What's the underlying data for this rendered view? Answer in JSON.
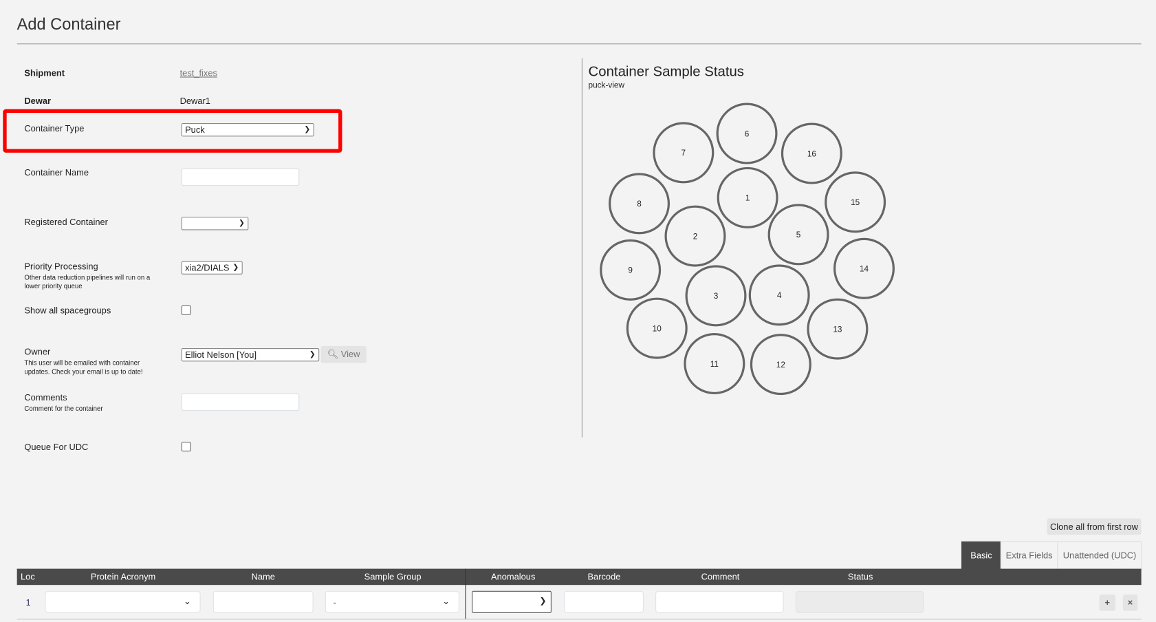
{
  "page": {
    "title": "Add Container"
  },
  "form": {
    "shipment": {
      "label": "Shipment",
      "value": "test_fixes"
    },
    "dewar": {
      "label": "Dewar",
      "value": "Dewar1"
    },
    "container_type": {
      "label": "Container Type",
      "value": "Puck"
    },
    "container_name": {
      "label": "Container Name",
      "value": ""
    },
    "registered_container": {
      "label": "Registered Container",
      "value": ""
    },
    "priority_processing": {
      "label": "Priority Processing",
      "help": "Other data reduction pipelines will run on a lower priority queue",
      "value": "xia2/DIALS"
    },
    "show_all_spacegroups": {
      "label": "Show all spacegroups",
      "checked": false
    },
    "owner": {
      "label": "Owner",
      "help": "This user will be emailed with container updates. Check your email is up to date!",
      "value": "Elliot Nelson [You]",
      "view_label": "View"
    },
    "comments": {
      "label": "Comments",
      "help": "Comment for the container",
      "value": ""
    },
    "queue_for_udc": {
      "label": "Queue For UDC",
      "checked": false
    }
  },
  "highlight_color": "#ff0000",
  "status_panel": {
    "title": "Container Sample Status",
    "subtitle": "puck-view",
    "positions": [
      "1",
      "2",
      "3",
      "4",
      "5",
      "6",
      "7",
      "8",
      "9",
      "10",
      "11",
      "12",
      "13",
      "14",
      "15",
      "16"
    ]
  },
  "samples": {
    "clone_label": "Clone all from first row",
    "tabs": [
      {
        "label": "Basic",
        "active": true
      },
      {
        "label": "Extra Fields",
        "active": false
      },
      {
        "label": "Unattended (UDC)",
        "active": false
      }
    ],
    "columns": [
      "Loc",
      "Protein Acronym",
      "Name",
      "Sample Group",
      "Anomalous",
      "Barcode",
      "Comment",
      "Status"
    ],
    "rows": [
      {
        "loc": "1",
        "protein": "",
        "name": "",
        "sample_group": "-",
        "anomalous": "",
        "barcode": "",
        "comment": "",
        "status": ""
      }
    ],
    "add_icon": "plus-icon",
    "remove_icon": "x-icon"
  }
}
